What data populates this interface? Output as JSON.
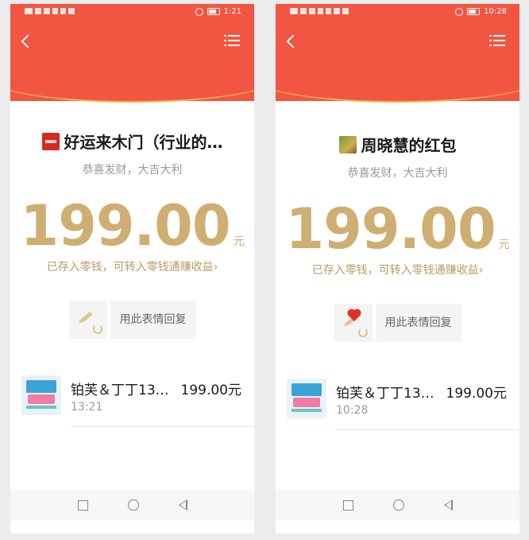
{
  "screens": [
    {
      "status_time": "1:21",
      "sender_name": "好运来木门（行业的…",
      "blessing": "恭喜发财，大吉大利",
      "amount": "199.00",
      "unit": "元",
      "stored_note": "已存入零钱，可转入零钱通赚收益",
      "stored_chevron": "›",
      "reply_label": "用此表情回复",
      "record": {
        "name": "铂芙＆丁丁13…",
        "amount": "199.00元",
        "time": "13:21"
      }
    },
    {
      "status_time": "10:28",
      "sender_name": "周晓慧的红包",
      "blessing": "恭喜发财，大吉大利",
      "amount": "199.00",
      "unit": "元",
      "stored_note": "已存入零钱，可转入零钱通赚收益",
      "stored_chevron": "›",
      "reply_label": "用此表情回复",
      "record": {
        "name": "铂芙＆丁丁13…",
        "amount": "199.00元",
        "time": "10:28"
      }
    }
  ],
  "icons": {
    "back": "back-arrow-icon",
    "menu": "list-menu-icon",
    "reply_sticker_left": "pen-sticker-icon",
    "reply_sticker_right": "heart-sticker-icon",
    "nav": [
      "square-recent-icon",
      "circle-home-icon",
      "triangle-back-icon"
    ]
  },
  "colors": {
    "header_red": "#f25542",
    "gold": "#cfae72",
    "gold_text": "#b89a64"
  }
}
